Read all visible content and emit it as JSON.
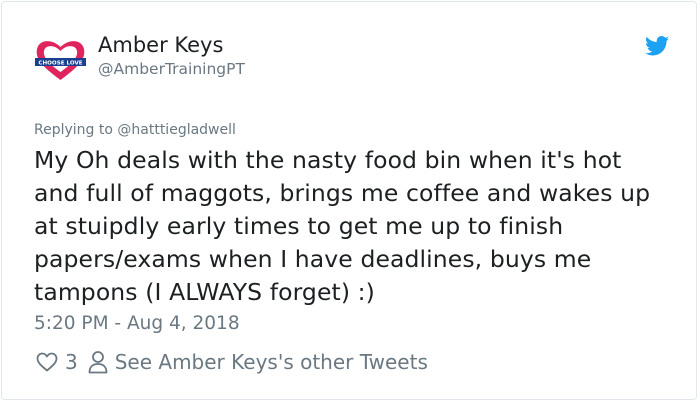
{
  "author": {
    "name": "Amber Keys",
    "handle": "@AmberTrainingPT",
    "avatar_banner_text": "CHOOSE LOVE",
    "avatar_icon": "heart-logo-icon"
  },
  "platform_icon": "twitter-bird-icon",
  "colors": {
    "accent": "#1da1f2",
    "heart_red": "#e0245e",
    "secondary_text": "#697882",
    "primary_text": "#1c2022",
    "border": "#e1e8ed"
  },
  "reply": {
    "prefix": "Replying to ",
    "mention": "@hatttiegladwell"
  },
  "tweet": {
    "lines": [
      "My Oh deals with the nasty food bin when it's hot",
      "and full of maggots, brings me coffee and wakes up",
      "at stuipdly early times to get me up to finish",
      "papers/exams when I have deadlines, buys me",
      "tampons (I ALWAYS forget) :)"
    ],
    "timestamp": "5:20 PM - Aug 4, 2018"
  },
  "actions": {
    "like_icon": "heart-outline-icon",
    "like_count": "3",
    "profile_icon": "person-outline-icon",
    "other_tweets_label": "See Amber Keys's other Tweets"
  }
}
